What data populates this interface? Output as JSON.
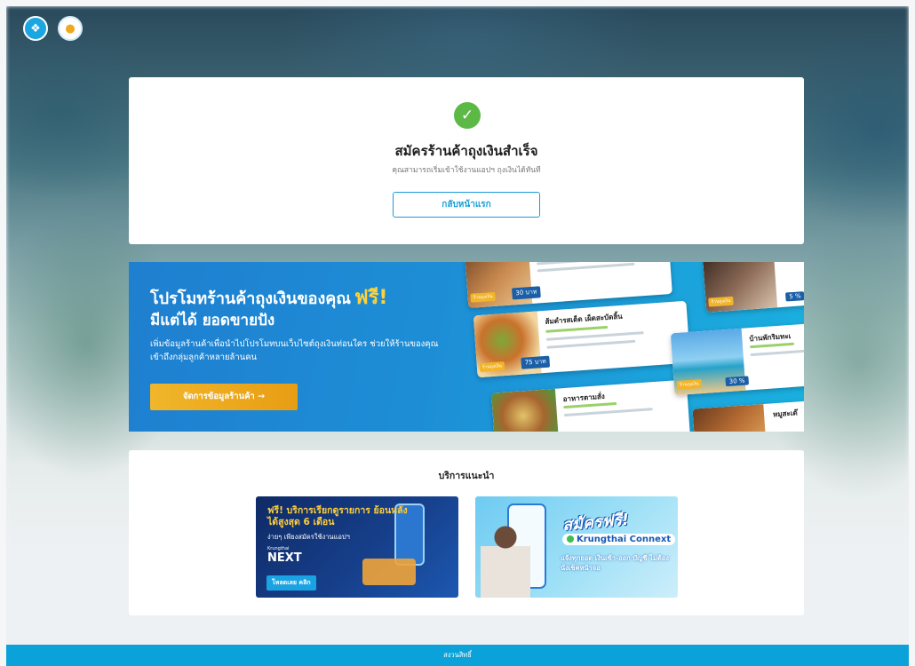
{
  "header": {
    "logo_left_icon": "krungthai-logo-icon",
    "logo_right_icon": "paotang-logo-icon"
  },
  "success": {
    "icon": "check-circle-icon",
    "title": "สมัครร้านค้าถุงเงินสำเร็จ",
    "subtitle": "คุณสามารถเริ่มเข้าใช้งานแอปฯ ถุงเงินได้ทันที",
    "home_button": "กลับหน้าแรก"
  },
  "promo": {
    "title_part1": "โปรโมทร้านค้าถุงเงินของคุณ",
    "title_free": "ฟรี!",
    "title_line2": "มีแต่ได้ ยอดขายปัง",
    "description": "เพิ่มข้อมูลร้านค้าเพื่อนำไปโปรโมทบนเว็บไซต์ถุงเงินท่อนใคร ช่วยให้ร้านของคุณเข้าถึงกลุ่มลูกค้าหลายล้านคน",
    "button": "จัดการข้อมูลร้านค้า →",
    "shops": [
      {
        "name": "",
        "price": "30 บาท"
      },
      {
        "name": "ส้มตำรสเด็ด เผ็ดสะบัดลิ้น",
        "price": "75 บาท"
      },
      {
        "name": "อาหารตามสั่ง",
        "price": ""
      },
      {
        "name": "",
        "price": "5 %"
      },
      {
        "name": "บ้านพักริมทะเ",
        "price": "30 %"
      },
      {
        "name": "หมูสะเต๊",
        "price": ""
      }
    ]
  },
  "services": {
    "title": "บริการแนะนำ",
    "next_banner": {
      "title": "ฟรี! บริการเรียกดูรายการ ย้อนหลังได้สูงสุด 6 เดือน",
      "subtitle": "ง่ายๆ เพียงสมัครใช้งานแอปฯ",
      "brand_small": "Krungthai",
      "brand": "NEXT",
      "button": "โหลดเลย คลิก"
    },
    "connext_banner": {
      "title": "สมัครฟรี!",
      "brand": "Krungthai Connext",
      "description": "แจ้งทุกยอด เงินเข้า-ออก บัญชี ไม่ต้องนั่งเช็คหน้าจอ"
    }
  },
  "footer": {
    "text": "สงวนสิทธิ์"
  },
  "colors": {
    "accent": "#1a9ed9",
    "success": "#5cb946",
    "promo_yellow": "#ffd23a",
    "button_orange": "#e89d14",
    "footer": "#0aa2d8"
  }
}
